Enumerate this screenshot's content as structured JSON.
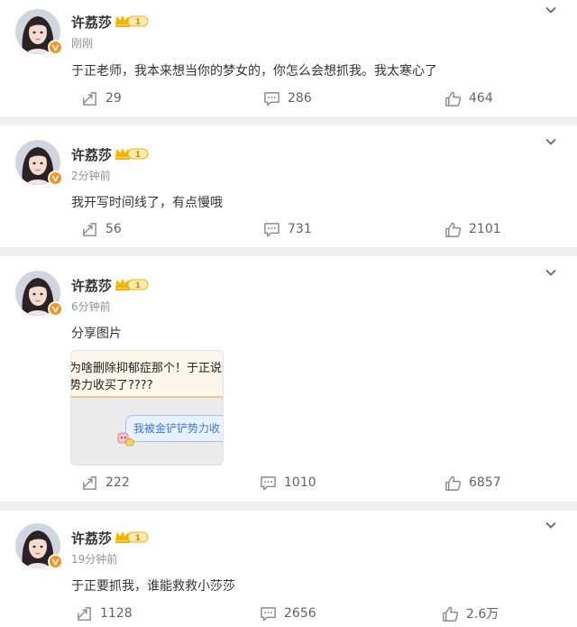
{
  "colors": {
    "badge": "#f7931e",
    "crown": "#f5b400",
    "text": "#333333",
    "meta": "#939393",
    "action": "#636363",
    "background": "#efefef"
  },
  "icons": {
    "more": "chevron-down-icon",
    "repost": "repost-icon",
    "comment": "comment-icon",
    "like": "thumbs-up-icon",
    "verified": "verified-v-badge-icon",
    "level": "crown-level-badge-icon"
  },
  "posts": [
    {
      "user": "许荔莎",
      "level": "1",
      "time": "刚刚",
      "text": "于正老师，我本来想当你的梦女的，你怎么会想抓我。我太寒心了",
      "reposts": "29",
      "comments": "286",
      "likes": "464"
    },
    {
      "user": "许荔莎",
      "level": "1",
      "time": "2分钟前",
      "text": "我开写时间线了，有点慢哦",
      "reposts": "56",
      "comments": "731",
      "likes": "2101"
    },
    {
      "user": "许荔莎",
      "level": "1",
      "time": "6分钟前",
      "text": "分享图片",
      "image": {
        "line1": "为啥删除抑郁症那个！于正说仿",
        "line2": "势力收买了????",
        "bubble": "我被金铲铲势力收"
      },
      "reposts": "222",
      "comments": "1010",
      "likes": "6857"
    },
    {
      "user": "许荔莎",
      "level": "1",
      "time": "19分钟前",
      "text": "于正要抓我，谁能救救小莎莎",
      "reposts": "1128",
      "comments": "2656",
      "likes": "2.6万"
    }
  ]
}
